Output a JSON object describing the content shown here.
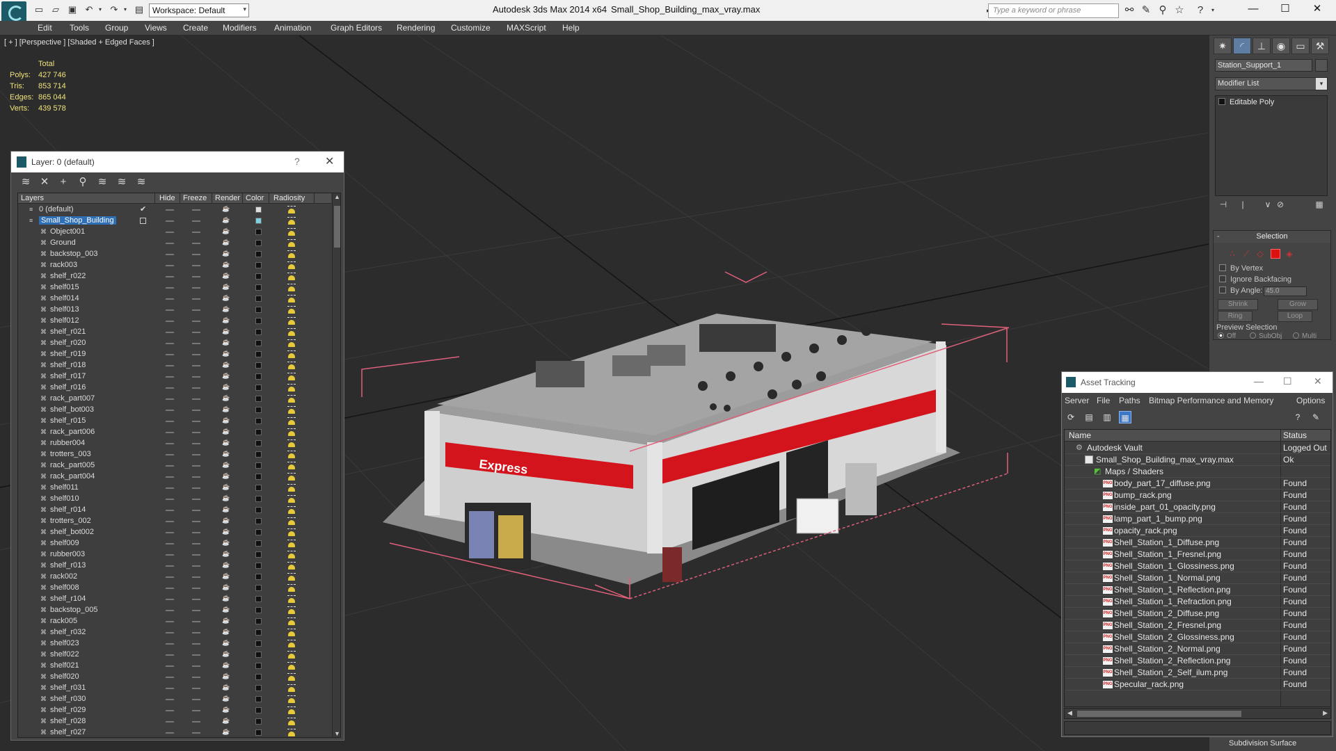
{
  "titlebar": {
    "workspace": "Workspace: Default",
    "app_title": "Autodesk 3ds Max  2014 x64",
    "file_title": "Small_Shop_Building_max_vray.max",
    "search_placeholder": "Type a keyword or phrase"
  },
  "menu": [
    "Edit",
    "Tools",
    "Group",
    "Views",
    "Create",
    "Modifiers",
    "Animation",
    "Graph Editors",
    "Rendering",
    "Customize",
    "MAXScript",
    "Help"
  ],
  "viewport": {
    "label": "[ + ] [Perspective ] [Shaded + Edged Faces ]",
    "stats_header": "Total",
    "stats": [
      {
        "k": "Polys:",
        "v": "427 746"
      },
      {
        "k": "Tris:",
        "v": "853 714"
      },
      {
        "k": "Edges:",
        "v": "865 044"
      },
      {
        "k": "Verts:",
        "v": "439 578"
      }
    ],
    "sign_text": "Express"
  },
  "layer_dialog": {
    "title": "Layer: 0 (default)",
    "help": "?",
    "close": "✕",
    "columns": [
      "Layers",
      "Hide",
      "Freeze",
      "Render",
      "Color",
      "Radiosity"
    ],
    "rows": [
      {
        "name": "0 (default)",
        "level": 0,
        "type": "layer",
        "check": true,
        "color": "#dddddd"
      },
      {
        "name": "Small_Shop_Building",
        "level": 0,
        "type": "layer",
        "selected": true,
        "color": "#7fd0e0"
      },
      {
        "name": "Object001",
        "level": 1,
        "type": "obj"
      },
      {
        "name": "Ground",
        "level": 1,
        "type": "obj"
      },
      {
        "name": "backstop_003",
        "level": 1,
        "type": "obj"
      },
      {
        "name": "rack003",
        "level": 1,
        "type": "obj"
      },
      {
        "name": "shelf_r022",
        "level": 1,
        "type": "obj"
      },
      {
        "name": "shelf015",
        "level": 1,
        "type": "obj"
      },
      {
        "name": "shelf014",
        "level": 1,
        "type": "obj"
      },
      {
        "name": "shelf013",
        "level": 1,
        "type": "obj"
      },
      {
        "name": "shelf012",
        "level": 1,
        "type": "obj"
      },
      {
        "name": "shelf_r021",
        "level": 1,
        "type": "obj"
      },
      {
        "name": "shelf_r020",
        "level": 1,
        "type": "obj"
      },
      {
        "name": "shelf_r019",
        "level": 1,
        "type": "obj"
      },
      {
        "name": "shelf_r018",
        "level": 1,
        "type": "obj"
      },
      {
        "name": "shelf_r017",
        "level": 1,
        "type": "obj"
      },
      {
        "name": "shelf_r016",
        "level": 1,
        "type": "obj"
      },
      {
        "name": "rack_part007",
        "level": 1,
        "type": "obj"
      },
      {
        "name": "shelf_bot003",
        "level": 1,
        "type": "obj"
      },
      {
        "name": "shelf_r015",
        "level": 1,
        "type": "obj"
      },
      {
        "name": "rack_part006",
        "level": 1,
        "type": "obj"
      },
      {
        "name": "rubber004",
        "level": 1,
        "type": "obj"
      },
      {
        "name": "trotters_003",
        "level": 1,
        "type": "obj"
      },
      {
        "name": "rack_part005",
        "level": 1,
        "type": "obj"
      },
      {
        "name": "rack_part004",
        "level": 1,
        "type": "obj"
      },
      {
        "name": "shelf011",
        "level": 1,
        "type": "obj"
      },
      {
        "name": "shelf010",
        "level": 1,
        "type": "obj"
      },
      {
        "name": "shelf_r014",
        "level": 1,
        "type": "obj"
      },
      {
        "name": "trotters_002",
        "level": 1,
        "type": "obj"
      },
      {
        "name": "shelf_bot002",
        "level": 1,
        "type": "obj"
      },
      {
        "name": "shelf009",
        "level": 1,
        "type": "obj"
      },
      {
        "name": "rubber003",
        "level": 1,
        "type": "obj"
      },
      {
        "name": "shelf_r013",
        "level": 1,
        "type": "obj"
      },
      {
        "name": "rack002",
        "level": 1,
        "type": "obj"
      },
      {
        "name": "shelf008",
        "level": 1,
        "type": "obj"
      },
      {
        "name": "shelf_r104",
        "level": 1,
        "type": "obj"
      },
      {
        "name": "backstop_005",
        "level": 1,
        "type": "obj"
      },
      {
        "name": "rack005",
        "level": 1,
        "type": "obj"
      },
      {
        "name": "shelf_r032",
        "level": 1,
        "type": "obj"
      },
      {
        "name": "shelf023",
        "level": 1,
        "type": "obj"
      },
      {
        "name": "shelf022",
        "level": 1,
        "type": "obj"
      },
      {
        "name": "shelf021",
        "level": 1,
        "type": "obj"
      },
      {
        "name": "shelf020",
        "level": 1,
        "type": "obj"
      },
      {
        "name": "shelf_r031",
        "level": 1,
        "type": "obj"
      },
      {
        "name": "shelf_r030",
        "level": 1,
        "type": "obj"
      },
      {
        "name": "shelf_r029",
        "level": 1,
        "type": "obj"
      },
      {
        "name": "shelf_r028",
        "level": 1,
        "type": "obj"
      },
      {
        "name": "shelf_r027",
        "level": 1,
        "type": "obj"
      }
    ]
  },
  "command_panel": {
    "object_name": "Station_Support_1",
    "modifier_list": "Modifier List",
    "stack_item": "Editable Poly",
    "selection": {
      "title": "Selection",
      "by_vertex": "By Vertex",
      "ignore_backfacing": "Ignore Backfacing",
      "by_angle": "By Angle:",
      "angle_value": "45.0",
      "shrink": "Shrink",
      "grow": "Grow",
      "ring": "Ring",
      "loop": "Loop",
      "preview": "Preview Selection",
      "off": "Off",
      "subobj": "SubObj",
      "multi": "Multi"
    },
    "subdivision": "Subdivision Surface"
  },
  "asset_tracking": {
    "title": "Asset Tracking",
    "menu": [
      "Server",
      "File",
      "Paths",
      "Bitmap Performance and Memory",
      "Options"
    ],
    "columns": {
      "name": "Name",
      "status": "Status"
    },
    "rows": [
      {
        "name": "Autodesk Vault",
        "status": "Logged Out",
        "level": 0,
        "icon": "vault"
      },
      {
        "name": "Small_Shop_Building_max_vray.max",
        "status": "Ok",
        "level": 1,
        "icon": "file"
      },
      {
        "name": "Maps / Shaders",
        "status": "",
        "level": 2,
        "icon": "map"
      },
      {
        "name": "body_part_17_diffuse.png",
        "status": "Found",
        "level": 3,
        "icon": "png"
      },
      {
        "name": "bump_rack.png",
        "status": "Found",
        "level": 3,
        "icon": "png"
      },
      {
        "name": "inside_part_01_opacity.png",
        "status": "Found",
        "level": 3,
        "icon": "png"
      },
      {
        "name": "lamp_part_1_bump.png",
        "status": "Found",
        "level": 3,
        "icon": "png"
      },
      {
        "name": "opacity_rack.png",
        "status": "Found",
        "level": 3,
        "icon": "png"
      },
      {
        "name": "Shell_Station_1_Diffuse.png",
        "status": "Found",
        "level": 3,
        "icon": "png"
      },
      {
        "name": "Shell_Station_1_Fresnel.png",
        "status": "Found",
        "level": 3,
        "icon": "png"
      },
      {
        "name": "Shell_Station_1_Glossiness.png",
        "status": "Found",
        "level": 3,
        "icon": "png"
      },
      {
        "name": "Shell_Station_1_Normal.png",
        "status": "Found",
        "level": 3,
        "icon": "png"
      },
      {
        "name": "Shell_Station_1_Reflection.png",
        "status": "Found",
        "level": 3,
        "icon": "png"
      },
      {
        "name": "Shell_Station_1_Refraction.png",
        "status": "Found",
        "level": 3,
        "icon": "png"
      },
      {
        "name": "Shell_Station_2_Diffuse.png",
        "status": "Found",
        "level": 3,
        "icon": "png"
      },
      {
        "name": "Shell_Station_2_Fresnel.png",
        "status": "Found",
        "level": 3,
        "icon": "png"
      },
      {
        "name": "Shell_Station_2_Glossiness.png",
        "status": "Found",
        "level": 3,
        "icon": "png"
      },
      {
        "name": "Shell_Station_2_Normal.png",
        "status": "Found",
        "level": 3,
        "icon": "png"
      },
      {
        "name": "Shell_Station_2_Reflection.png",
        "status": "Found",
        "level": 3,
        "icon": "png"
      },
      {
        "name": "Shell_Station_2_Self_ilum.png",
        "status": "Found",
        "level": 3,
        "icon": "png"
      },
      {
        "name": "Specular_rack.png",
        "status": "Found",
        "level": 3,
        "icon": "png"
      }
    ]
  },
  "colors": {
    "selection_blue": "#2f6fb6",
    "stats_yellow": "#f0e27a",
    "bbox_pink": "#e0607a",
    "shop_red": "#d4141c"
  }
}
